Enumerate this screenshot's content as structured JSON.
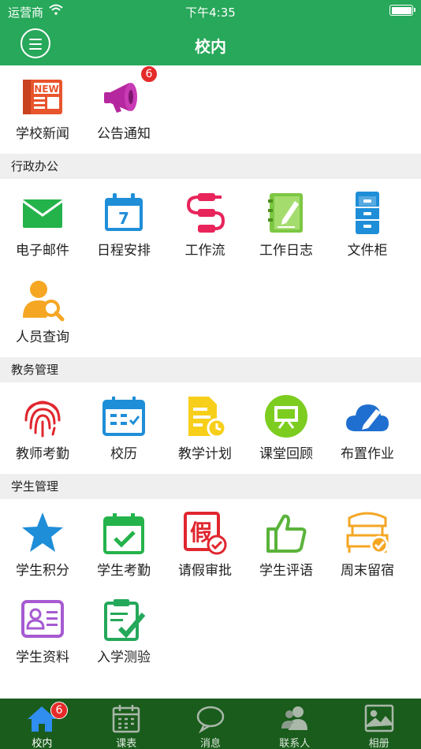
{
  "status_bar": {
    "carrier": "运营商",
    "time": "下午4:35"
  },
  "nav": {
    "title": "校内"
  },
  "sections": [
    {
      "title": "",
      "items": [
        {
          "label": "学校新闻",
          "icon": "news-icon",
          "badge": ""
        },
        {
          "label": "公告通知",
          "icon": "megaphone-icon",
          "badge": "6"
        }
      ]
    },
    {
      "title": "行政办公",
      "items": [
        {
          "label": "电子邮件",
          "icon": "mail-icon",
          "badge": ""
        },
        {
          "label": "日程安排",
          "icon": "calendar-icon",
          "badge": ""
        },
        {
          "label": "工作流",
          "icon": "workflow-icon",
          "badge": ""
        },
        {
          "label": "工作日志",
          "icon": "notebook-icon",
          "badge": ""
        },
        {
          "label": "文件柜",
          "icon": "cabinet-icon",
          "badge": ""
        },
        {
          "label": "人员查询",
          "icon": "person-search-icon",
          "badge": ""
        }
      ]
    },
    {
      "title": "教务管理",
      "items": [
        {
          "label": "教师考勤",
          "icon": "fingerprint-icon",
          "badge": ""
        },
        {
          "label": "校历",
          "icon": "school-calendar-icon",
          "badge": ""
        },
        {
          "label": "教学计划",
          "icon": "plan-icon",
          "badge": ""
        },
        {
          "label": "课堂回顾",
          "icon": "classroom-icon",
          "badge": ""
        },
        {
          "label": "布置作业",
          "icon": "cloud-edit-icon",
          "badge": ""
        }
      ]
    },
    {
      "title": "学生管理",
      "items": [
        {
          "label": "学生积分",
          "icon": "star-icon",
          "badge": ""
        },
        {
          "label": "学生考勤",
          "icon": "check-calendar-icon",
          "badge": ""
        },
        {
          "label": "请假审批",
          "icon": "leave-icon",
          "badge": ""
        },
        {
          "label": "学生评语",
          "icon": "thumbs-up-icon",
          "badge": ""
        },
        {
          "label": "周末留宿",
          "icon": "bed-icon",
          "badge": ""
        },
        {
          "label": "学生资料",
          "icon": "id-card-icon",
          "badge": ""
        },
        {
          "label": "入学测验",
          "icon": "clipboard-check-icon",
          "badge": ""
        }
      ]
    }
  ],
  "tabs": [
    {
      "label": "校内",
      "icon": "home-icon",
      "badge": "6",
      "active": true
    },
    {
      "label": "课表",
      "icon": "timetable-icon",
      "badge": "",
      "active": false
    },
    {
      "label": "消息",
      "icon": "chat-icon",
      "badge": "",
      "active": false
    },
    {
      "label": "联系人",
      "icon": "contacts-icon",
      "badge": "",
      "active": false
    },
    {
      "label": "相册",
      "icon": "album-icon",
      "badge": "",
      "active": false
    }
  ],
  "colors": {
    "primary": "#27a85a",
    "tab_bar": "#1a5c1c",
    "badge": "#e62a2a",
    "section_bg": "#efefef"
  }
}
